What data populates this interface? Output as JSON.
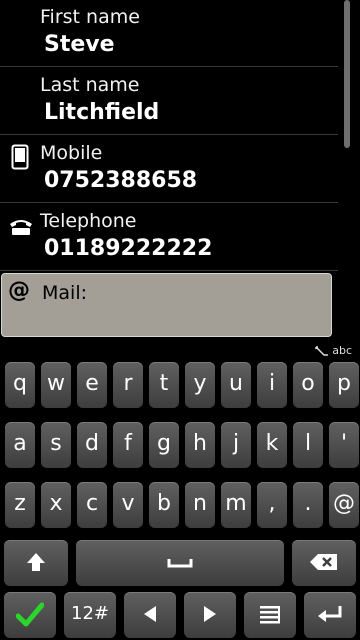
{
  "contact": {
    "first_name": {
      "label": "First name",
      "value": "Steve"
    },
    "last_name": {
      "label": "Last name",
      "value": "Litchfield"
    },
    "mobile": {
      "label": "Mobile",
      "value": "0752388658",
      "icon": "mobile-phone-icon"
    },
    "telephone": {
      "label": "Telephone",
      "value": "01189222222",
      "icon": "telephone-icon"
    },
    "mail": {
      "label": "Mail:",
      "value": "",
      "icon": "at-icon"
    }
  },
  "input_mode": "abc",
  "keyboard": {
    "row1": [
      "q",
      "w",
      "e",
      "r",
      "t",
      "y",
      "u",
      "i",
      "o",
      "p"
    ],
    "row2": [
      "a",
      "s",
      "d",
      "f",
      "g",
      "h",
      "j",
      "k",
      "l",
      "'"
    ],
    "row3": [
      "z",
      "x",
      "c",
      "v",
      "b",
      "n",
      "m",
      ",",
      ".",
      "@"
    ],
    "symbols_label": "12#",
    "icons": {
      "shift": "shift-arrow-icon",
      "space": "space-bar-icon",
      "backspace": "backspace-icon",
      "done": "check-icon",
      "left": "left-arrow-icon",
      "right": "right-arrow-icon",
      "menu": "menu-icon",
      "enter": "enter-icon"
    },
    "done_color": "#2bd62b"
  }
}
